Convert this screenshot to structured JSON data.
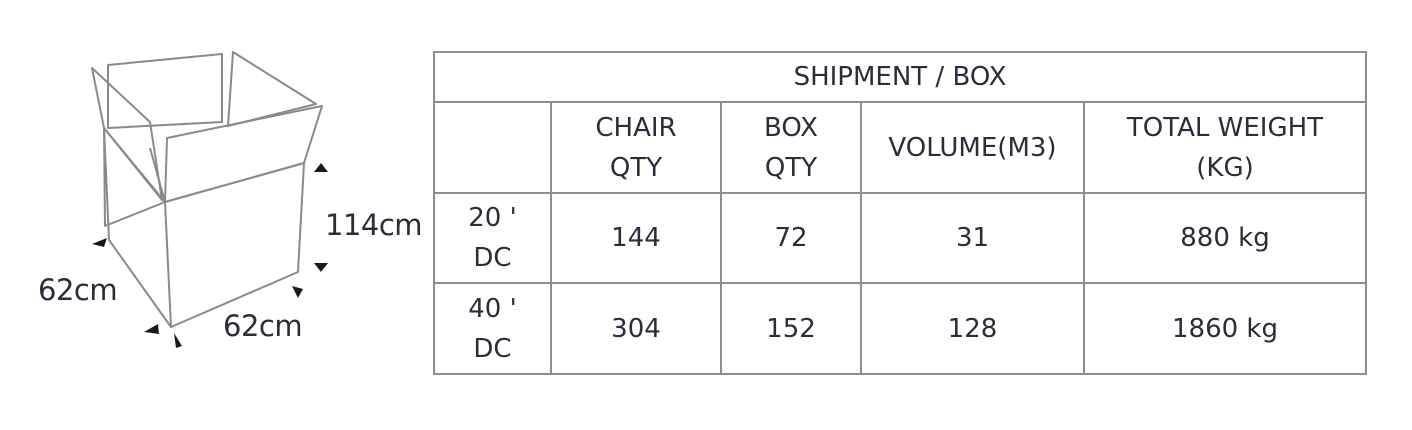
{
  "figure": {
    "height_label": "114cm",
    "depth_label": "62cm",
    "width_label": "62cm"
  },
  "table": {
    "title": "SHIPMENT / BOX",
    "headers": [
      [
        "CHAIR",
        "QTY"
      ],
      [
        "BOX",
        "QTY"
      ],
      [
        "VOLUME(M3)"
      ],
      [
        "TOTAL WEIGHT",
        "(KG)"
      ]
    ],
    "rows": [
      {
        "container": [
          "20 '",
          "DC"
        ],
        "chair_qty": "144",
        "box_qty": "72",
        "volume": "31",
        "total_weight": "880 kg"
      },
      {
        "container": [
          "40 '",
          "DC"
        ],
        "chair_qty": "304",
        "box_qty": "152",
        "volume": "128",
        "total_weight": "1860 kg"
      }
    ]
  }
}
